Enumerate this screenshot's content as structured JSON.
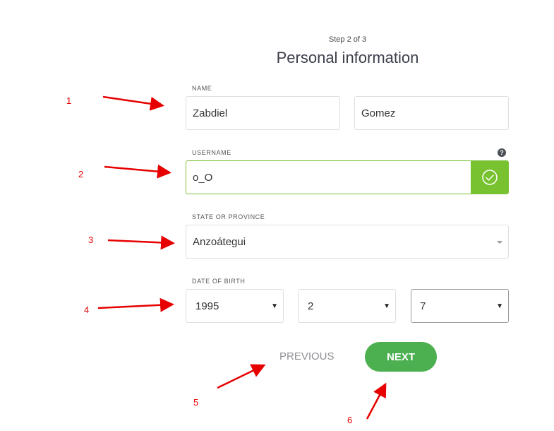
{
  "header": {
    "step": "Step 2 of 3",
    "title": "Personal information"
  },
  "name": {
    "label": "NAME",
    "first": "Zabdiel",
    "last": "Gomez"
  },
  "username": {
    "label": "USERNAME",
    "value": "o_O",
    "help": "?",
    "status": "valid"
  },
  "state": {
    "label": "STATE OR PROVINCE",
    "value": "Anzoátegui"
  },
  "dob": {
    "label": "DATE OF BIRTH",
    "year": "1995",
    "month": "2",
    "day": "7"
  },
  "actions": {
    "previous": "PREVIOUS",
    "next": "NEXT"
  },
  "annotations": [
    "1",
    "2",
    "3",
    "4",
    "5",
    "6"
  ],
  "colors": {
    "accent_green": "#4cb050",
    "valid_green": "#78c22f",
    "annotation_red": "#e60000"
  }
}
